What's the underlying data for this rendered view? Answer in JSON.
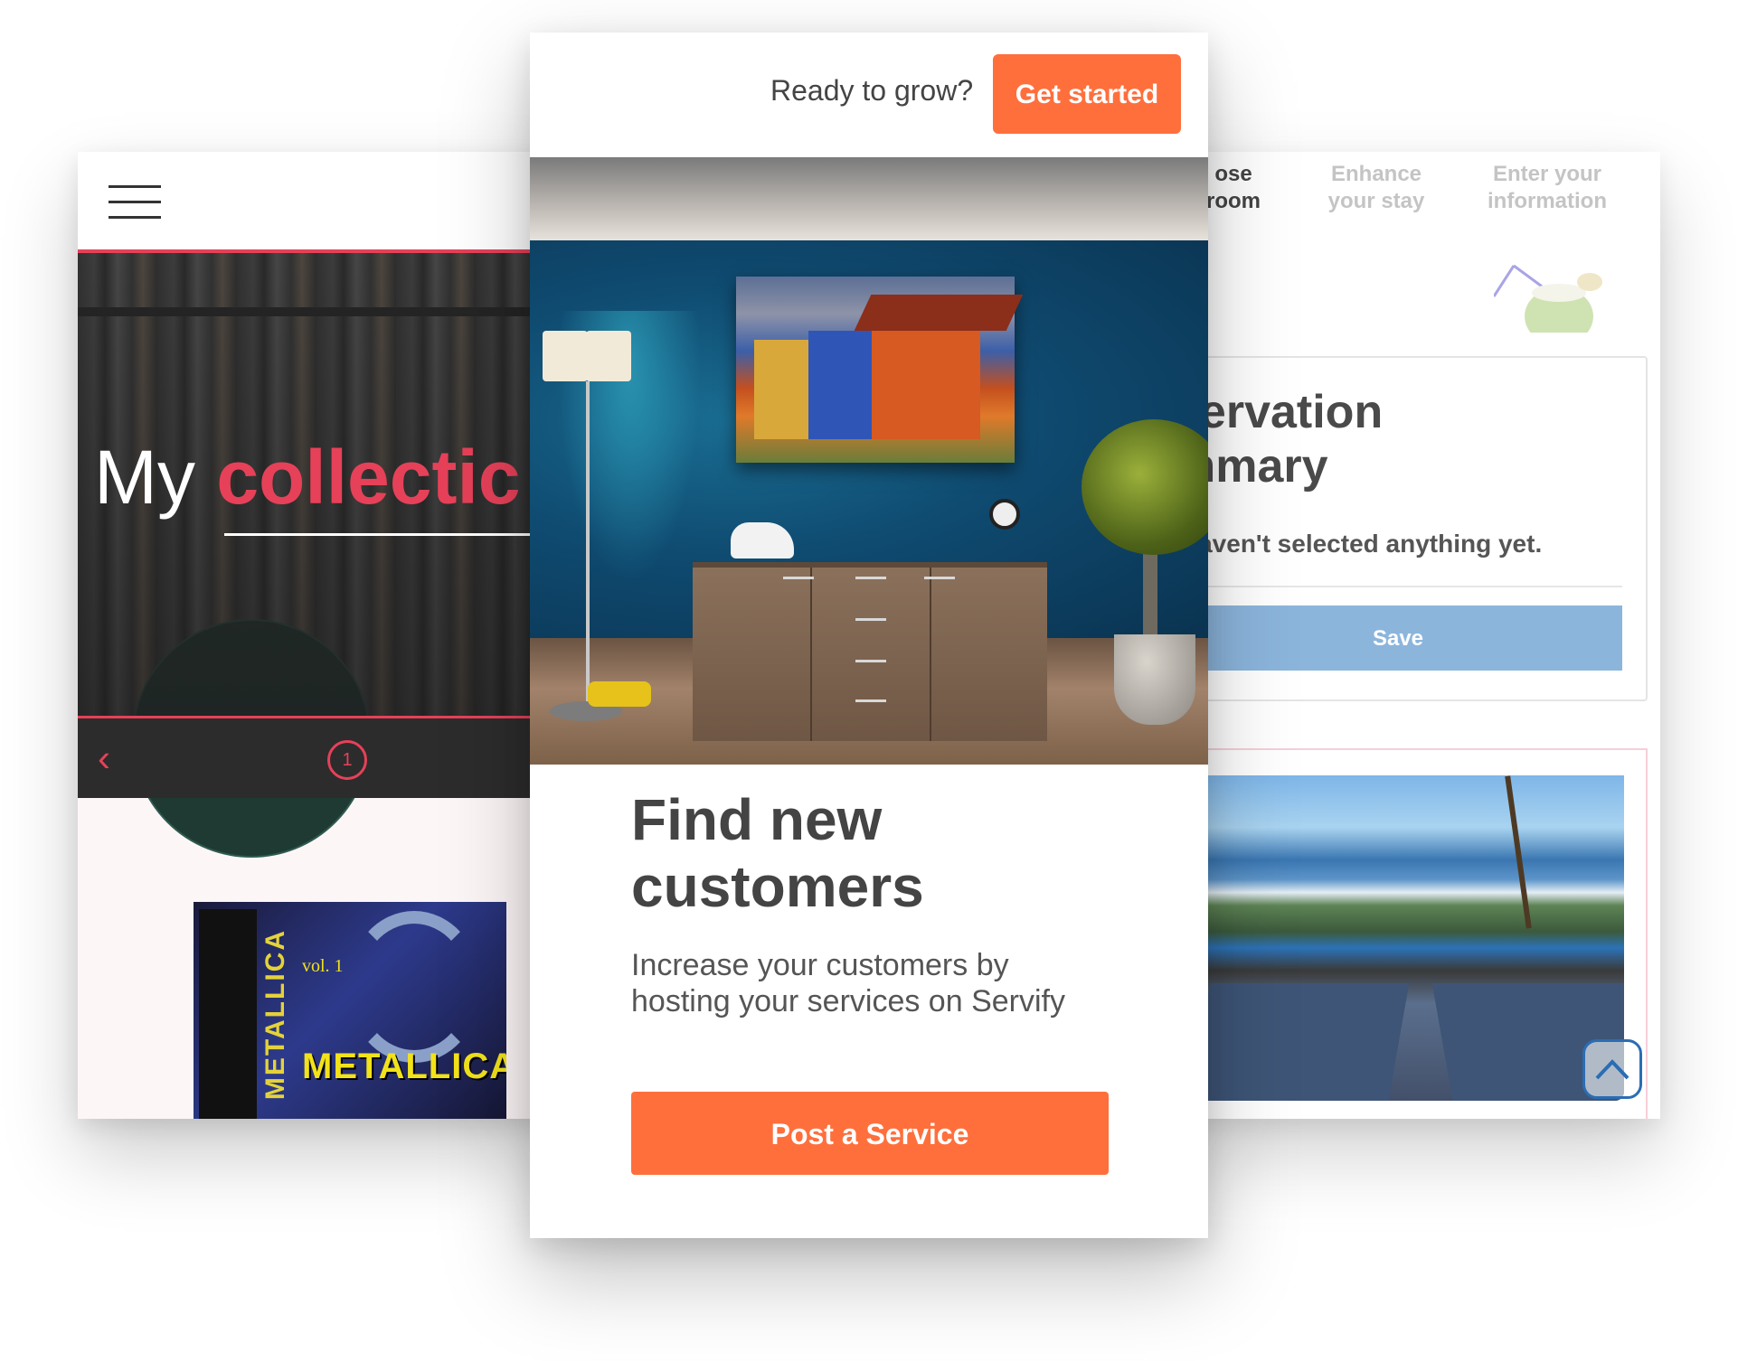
{
  "left_card": {
    "hero_title_prefix": "My",
    "hero_title_accent": "collectic",
    "pager_prev": "‹",
    "pager_page": "1",
    "album_band": "METALLICA",
    "album_logo": "METALLICA",
    "album_vol": "vol. 1",
    "colors": {
      "accent": "#e64159",
      "pager_bg": "#2c2c2c"
    }
  },
  "center_card": {
    "header_prompt": "Ready to grow?",
    "get_started_label": "Get started",
    "headline": "Find new\ncustomers",
    "description": "Increase your customers by hosting your services on Servify",
    "post_service_label": "Post a Service",
    "colors": {
      "accent": "#ff6f3c"
    }
  },
  "right_card": {
    "steps": [
      {
        "label": "ose\nroom",
        "state": "active"
      },
      {
        "label": "Enhance\nyour stay",
        "state": "inactive"
      },
      {
        "label": "Enter your\ninformation",
        "state": "inactive"
      }
    ],
    "summary_title": "servation\nmmary",
    "summary_empty": "haven't selected anything yet.",
    "save_label": "Save",
    "colors": {
      "save_bg": "#8cb5dc",
      "scroll_top_border": "#2b6db3"
    }
  }
}
